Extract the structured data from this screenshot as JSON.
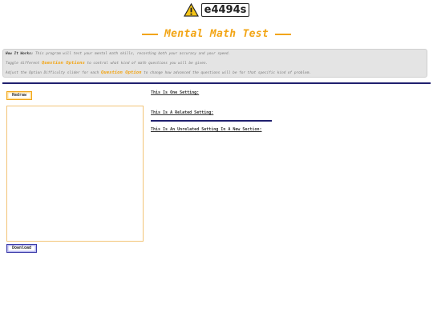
{
  "header": {
    "logo_text": "e4494s",
    "title": "Mental Math Test"
  },
  "info": {
    "line1_label": "How It Works:",
    "line1_text": "This program will test your mental math skills, recording both your accuracy and your speed.",
    "line2_pre": "Toggle different",
    "line2_opt": "Question Options",
    "line2_post": "to control what kind of math questions you will be given.",
    "line3_pre": "Adjust the Option Difficulty slider for each",
    "line3_opt": "Question Option",
    "line3_post": "to change how advanced the questions will be for that specific kind of problem."
  },
  "controls": {
    "redraw_label": "Redraw",
    "download_label": "Download"
  },
  "settings": {
    "one": "This Is One Setting:",
    "related": "This Is A Related Setting:",
    "unrelated": "This Is An Unrelated Setting In A New Section:"
  },
  "colors": {
    "accent": "#f2a516",
    "navy": "#1f1f6e"
  }
}
